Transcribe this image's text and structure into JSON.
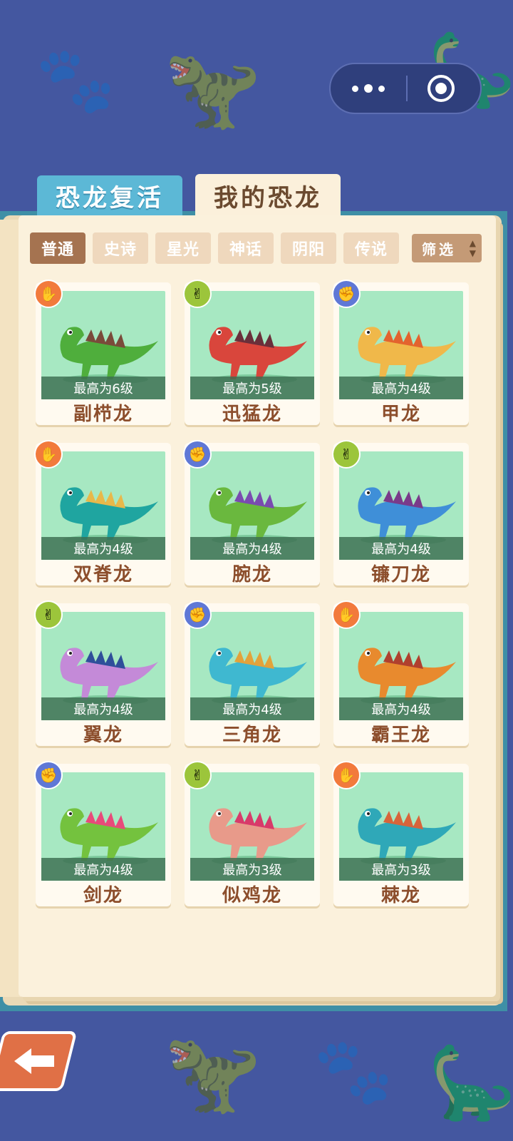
{
  "tabs": [
    {
      "label": "恐龙复活",
      "active": false
    },
    {
      "label": "我的恐龙",
      "active": true
    }
  ],
  "filters": [
    {
      "label": "普通",
      "active": true
    },
    {
      "label": "史诗",
      "active": false
    },
    {
      "label": "星光",
      "active": false
    },
    {
      "label": "神话",
      "active": false
    },
    {
      "label": "阴阳",
      "active": false
    },
    {
      "label": "传说",
      "active": false
    }
  ],
  "sort": {
    "label": "筛选"
  },
  "dinos": [
    {
      "name": "副栉龙",
      "level": "最高为6级",
      "badge": "paper",
      "color": "#4fae3c",
      "accent": "#7a4a3a"
    },
    {
      "name": "迅猛龙",
      "level": "最高为5级",
      "badge": "scissors",
      "color": "#d9463c",
      "accent": "#6a2f3a"
    },
    {
      "name": "甲龙",
      "level": "最高为4级",
      "badge": "rock",
      "color": "#f0b84a",
      "accent": "#e3632e"
    },
    {
      "name": "双脊龙",
      "level": "最高为4级",
      "badge": "paper",
      "color": "#1fa5a0",
      "accent": "#e8b84a"
    },
    {
      "name": "腕龙",
      "level": "最高为4级",
      "badge": "rock",
      "color": "#6ab83e",
      "accent": "#7a4ab0"
    },
    {
      "name": "镰刀龙",
      "level": "最高为4级",
      "badge": "scissors",
      "color": "#3f8fd8",
      "accent": "#7a3a8a"
    },
    {
      "name": "翼龙",
      "level": "最高为4级",
      "badge": "scissors",
      "color": "#c48ad8",
      "accent": "#2f4f9a"
    },
    {
      "name": "三角龙",
      "level": "最高为4级",
      "badge": "rock",
      "color": "#3fb8d0",
      "accent": "#e3a23a"
    },
    {
      "name": "霸王龙",
      "level": "最高为4级",
      "badge": "paper",
      "color": "#e88a2e",
      "accent": "#b0402e"
    },
    {
      "name": "剑龙",
      "level": "最高为4级",
      "badge": "rock",
      "color": "#74c23e",
      "accent": "#e84a7a"
    },
    {
      "name": "似鸡龙",
      "level": "最高为3级",
      "badge": "scissors",
      "color": "#e89a8a",
      "accent": "#d83a6a"
    },
    {
      "name": "棘龙",
      "level": "最高为3级",
      "badge": "paper",
      "color": "#2fa8b8",
      "accent": "#d8643a"
    }
  ],
  "icons": {
    "paper": "✋",
    "scissors": "✌",
    "rock": "✊",
    "back": "back-arrow-icon"
  }
}
